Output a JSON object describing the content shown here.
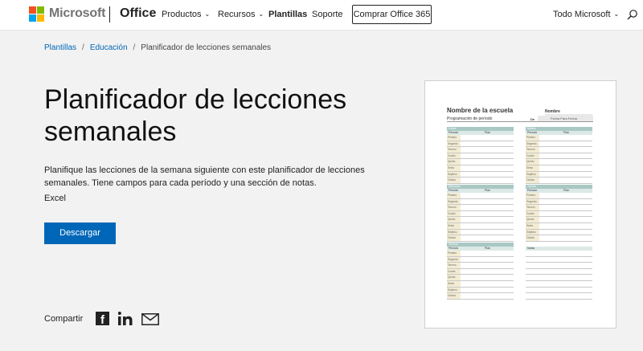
{
  "header": {
    "brand": "Microsoft",
    "product": "Office",
    "nav": [
      {
        "label": "Productos",
        "has_dropdown": true
      },
      {
        "label": "Recursos",
        "has_dropdown": true
      },
      {
        "label": "Plantillas",
        "has_dropdown": false
      },
      {
        "label": "Soporte",
        "has_dropdown": false
      }
    ],
    "buy_label": "Comprar Office 365",
    "all_microsoft": "Todo Microsoft",
    "search_icon": "search-icon"
  },
  "breadcrumb": {
    "items": [
      "Plantillas",
      "Educación"
    ],
    "current": "Planificador de lecciones semanales",
    "separator": "/"
  },
  "main": {
    "title": "Planificador de lecciones semanales",
    "description": "Planifique las lecciones de la semana siguiente con este planificador de lecciones semanales. Tiene campos para cada período y una sección de notas.",
    "app": "Excel",
    "download_label": "Descargar",
    "share_label": "Compartir",
    "share_icons": [
      "facebook-icon",
      "linkedin-icon",
      "mail-icon"
    ]
  },
  "preview": {
    "school": "Nombre de la escuela",
    "name_label": "Nombre",
    "program": "Programación de período",
    "de": "De",
    "fecha": "Fecha  Para  Fecha",
    "col_period": "Período",
    "col_plan": "Plan",
    "periods": [
      "Primero",
      "Segundo",
      "Tercero",
      "Cuarto",
      "Quinto",
      "Sexto",
      "Séptimo",
      "Octavo"
    ],
    "days": [
      "Lunes",
      "Martes",
      "Miércoles",
      "Jueves",
      "Viernes"
    ],
    "notes": "Notas"
  },
  "colors": {
    "accent": "#0067b8",
    "teal_header": "#a9c8c4",
    "label_fill": "#f3ecd2"
  }
}
